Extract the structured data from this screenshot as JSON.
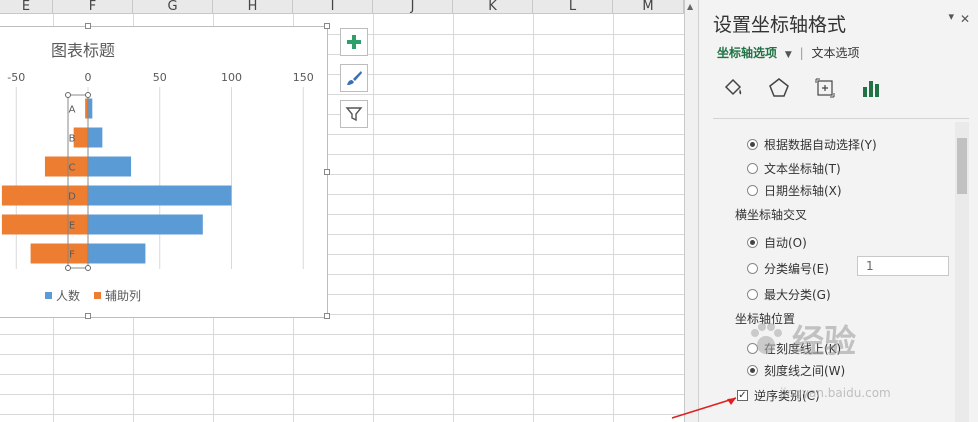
{
  "spreadsheet": {
    "columns": [
      "E",
      "F",
      "G",
      "H",
      "I",
      "J",
      "K",
      "L",
      "M"
    ]
  },
  "chart": {
    "title": "图表标题",
    "legend": [
      {
        "name": "人数",
        "color": "#5b9bd5"
      },
      {
        "name": "辅助列",
        "color": "#ed7d31"
      }
    ]
  },
  "chart_data": {
    "type": "bar",
    "orientation": "horizontal",
    "categories": [
      "A",
      "B",
      "C",
      "D",
      "E",
      "F"
    ],
    "series": [
      {
        "name": "人数",
        "values": [
          3,
          10,
          30,
          100,
          80,
          40
        ],
        "color": "#5b9bd5"
      },
      {
        "name": "辅助列",
        "values": [
          -2,
          -10,
          -30,
          -60,
          -60,
          -40
        ],
        "color": "#ed7d31"
      }
    ],
    "xticks": [
      -50,
      0,
      50,
      100,
      150
    ],
    "xlim": [
      -60,
      160
    ],
    "title": "图表标题",
    "legend_position": "bottom"
  },
  "float_buttons": [
    {
      "name": "chart-elements-button",
      "icon": "plus-icon"
    },
    {
      "name": "chart-styles-button",
      "icon": "brush-icon"
    },
    {
      "name": "chart-filters-button",
      "icon": "filter-icon"
    }
  ],
  "panel": {
    "title": "设置坐标轴格式",
    "dropdown_glyph": "▾",
    "close_glyph": "✕",
    "tab_axis_options": "坐标轴选项",
    "tab_axis_arrow": "▼",
    "tab_text_options": "文本选项",
    "icons": [
      "fill-line-icon",
      "effects-icon",
      "size-properties-icon",
      "axis-options-icon"
    ],
    "options_group1": [
      {
        "label": "根据数据自动选择(Y)",
        "selected": true
      },
      {
        "label": "文本坐标轴(T)",
        "selected": false
      },
      {
        "label": "日期坐标轴(X)",
        "selected": false
      }
    ],
    "cross_heading": "横坐标轴交叉",
    "options_group2": [
      {
        "label": "自动(O)",
        "selected": true
      },
      {
        "label": "分类编号(E)",
        "selected": false
      },
      {
        "label": "最大分类(G)",
        "selected": false
      }
    ],
    "category_number_value": "1",
    "position_heading": "坐标轴位置",
    "options_group3": [
      {
        "label": "在刻度线上(K)",
        "selected": false
      },
      {
        "label": "刻度线之间(W)",
        "selected": true
      }
    ],
    "reverse_label": "逆序类别(C)",
    "reverse_checked": true,
    "check_glyph": "✓"
  },
  "watermark": {
    "text": "经验",
    "url": "jingyan.baidu.com"
  }
}
